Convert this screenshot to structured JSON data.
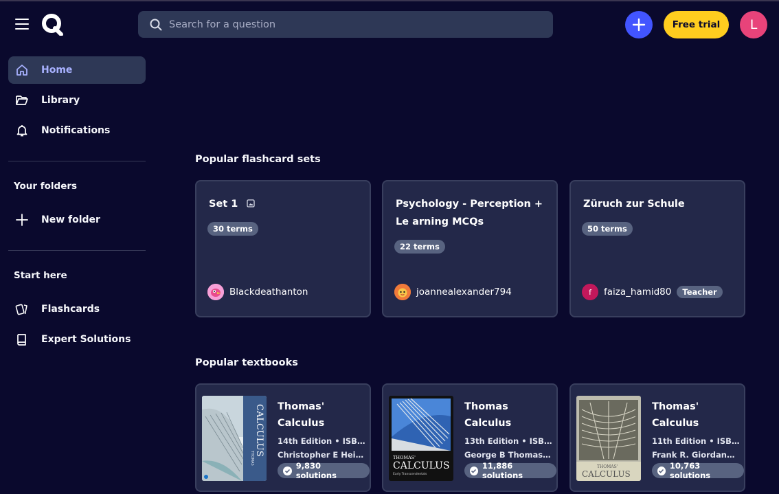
{
  "header": {
    "search_placeholder": "Search for a question",
    "free_trial_label": "Free trial",
    "avatar_initial": "L"
  },
  "sidebar": {
    "home": "Home",
    "library": "Library",
    "notifications": "Notifications",
    "your_folders": "Your folders",
    "new_folder": "New folder",
    "start_here": "Start here",
    "flashcards": "Flashcards",
    "expert_solutions": "Expert Solutions"
  },
  "flashcards_section": {
    "title": "Popular flashcard sets",
    "sets": [
      {
        "title": "Set 1",
        "terms": "30 terms",
        "creator": "Blackdeathanton",
        "teacher": ""
      },
      {
        "title": "Psychology - Perception + Le arning MCQs",
        "terms": "22 terms",
        "creator": "joannealexander794",
        "teacher": ""
      },
      {
        "title": "Züruch zur Schule",
        "terms": "50 terms",
        "creator": "faiza_hamid80",
        "teacher": "Teacher",
        "creator_initial": "f"
      }
    ]
  },
  "textbooks_section": {
    "title": "Popular textbooks",
    "books": [
      {
        "title": "Thomas' Calculus",
        "edition": "14th Edition • ISBN: ...",
        "authors": "Christopher E Heil, ...",
        "solutions": "9,830 solutions",
        "cover_title": "CALCULUS",
        "cover_author": "THOMAS"
      },
      {
        "title": "Thomas Calculus",
        "edition": "13th Edition • ISBN: ...",
        "authors": "George B Thomas Jr....",
        "solutions": "11,886 solutions",
        "cover_title": "CALCULUS",
        "cover_author": "THOMAS'",
        "cover_sub": "Early Transcendentals"
      },
      {
        "title": "Thomas' Calculus",
        "edition": "11th Edition • ISBN: ...",
        "authors": "Frank R. Giordano, ...",
        "solutions": "10,763 solutions",
        "cover_title": "CALCULUS",
        "cover_author": "THOMAS'"
      }
    ]
  },
  "colors": {
    "background": "#0a092d",
    "accent": "#4255ff",
    "trial": "#ffcd1f",
    "avatar": "#e8437a",
    "active_nav_text": "#a8b1ff"
  }
}
